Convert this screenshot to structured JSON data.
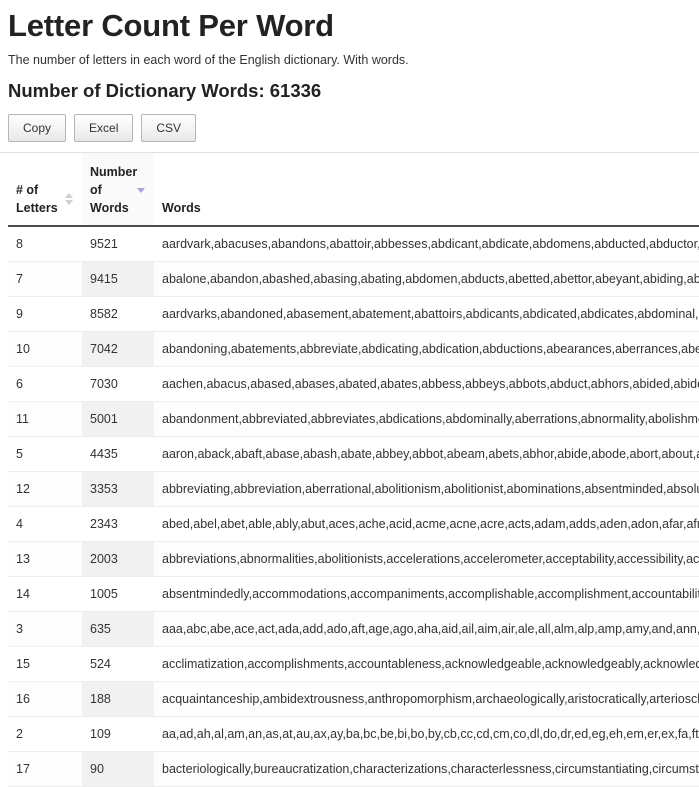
{
  "header": {
    "title": "Letter Count Per Word",
    "subtitle": "The number of letters in each word of the English dictionary. With words.",
    "count_heading": "Number of Dictionary Words: 61336"
  },
  "toolbar": {
    "copy_label": "Copy",
    "excel_label": "Excel",
    "csv_label": "CSV"
  },
  "table": {
    "columns": [
      {
        "label": "# of Letters",
        "sort": "none"
      },
      {
        "label": "Number of Words",
        "sort": "desc"
      },
      {
        "label": "Words",
        "sort": "none"
      }
    ],
    "rows": [
      {
        "letters": "8",
        "count": "9521",
        "words": "aardvark,abacuses,abandons,abattoir,abbesses,abdicant,abdicate,abdomens,abducted,abductor,aberrant"
      },
      {
        "letters": "7",
        "count": "9415",
        "words": "abalone,abandon,abashed,abasing,abating,abdomen,abducts,abetted,abettor,abeyant,abiding,abidjan,ab"
      },
      {
        "letters": "9",
        "count": "8582",
        "words": "aardvarks,abandoned,abasement,abatement,abattoirs,abdicants,abdicated,abdicates,abdominal,abducting"
      },
      {
        "letters": "10",
        "count": "7042",
        "words": "abandoning,abatements,abbreviate,abdicating,abdication,abductions,abearances,aberrances,aberrating,"
      },
      {
        "letters": "6",
        "count": "7030",
        "words": "aachen,abacus,abased,abases,abated,abates,abbess,abbeys,abbots,abduct,abhors,abided,abides,abject,a"
      },
      {
        "letters": "11",
        "count": "5001",
        "words": "abandonment,abbreviated,abbreviates,abdications,abdominally,aberrations,abnormality,abolishment,abo"
      },
      {
        "letters": "5",
        "count": "4435",
        "words": "aaron,aback,abaft,abase,abash,abate,abbey,abbot,abeam,abets,abhor,abide,abode,abort,about,above,ab"
      },
      {
        "letters": "12",
        "count": "3353",
        "words": "abbreviating,abbreviation,aberrational,abolitionism,abolitionist,abominations,absentminded,absolutenes"
      },
      {
        "letters": "4",
        "count": "2343",
        "words": "abed,abel,abet,able,ably,abut,aces,ache,acid,acme,acne,acre,acts,adam,adds,aden,adon,afar,afro,aged,ag"
      },
      {
        "letters": "13",
        "count": "2003",
        "words": "abbreviations,abnormalities,abolitionists,accelerations,accelerometer,acceptability,accessibility,acclimatiz"
      },
      {
        "letters": "14",
        "count": "1005",
        "words": "absentmindedly,accommodations,accompaniments,accomplishable,accomplishment,accountability,ackn"
      },
      {
        "letters": "3",
        "count": "635",
        "words": "aaa,abc,abe,ace,act,ada,add,ado,aft,age,ago,aha,aid,ail,aim,air,ale,all,alm,alp,amp,amy,and,ann,ant,any,ap"
      },
      {
        "letters": "15",
        "count": "524",
        "words": "acclimatization,accomplishments,accountableness,acknowledgeable,acknowledgeably,acknowledgments"
      },
      {
        "letters": "16",
        "count": "188",
        "words": "acquaintanceship,ambidextrousness,anthropomorphism,archaeologically,aristocratically,arteriosclerosis,a"
      },
      {
        "letters": "2",
        "count": "109",
        "words": "aa,ad,ah,al,am,an,as,at,au,ax,ay,ba,bc,be,bi,bo,by,cb,cc,cd,cm,co,dl,do,dr,ed,eg,eh,em,er,ex,fa,ft,gb,gm,go,"
      },
      {
        "letters": "17",
        "count": "90",
        "words": "bacteriologically,bureaucratization,characterizations,characterlessness,circumstantiating,circumstantiatio"
      }
    ]
  },
  "colors": {
    "sort_active": "#a9a2e0",
    "sort_inactive": "#d0d0d0",
    "text": "#333333",
    "heading": "#222222"
  }
}
